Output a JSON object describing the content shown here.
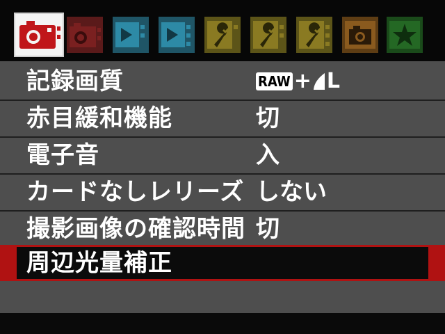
{
  "tabs": [
    {
      "name": "shooting-tab-1",
      "icon": "camera-icon",
      "color": "#c02020",
      "active": true
    },
    {
      "name": "shooting-tab-2",
      "icon": "camera-icon",
      "color": "#c02020",
      "active": false
    },
    {
      "name": "playback-tab-1",
      "icon": "playback-icon",
      "color": "#3aa8c8",
      "active": false
    },
    {
      "name": "playback-tab-2",
      "icon": "playback-icon",
      "color": "#3aa8c8",
      "active": false
    },
    {
      "name": "setup-tab-1",
      "icon": "wrench-icon",
      "color": "#c8b020",
      "active": false
    },
    {
      "name": "setup-tab-2",
      "icon": "wrench-icon",
      "color": "#c8b020",
      "active": false
    },
    {
      "name": "setup-tab-3",
      "icon": "wrench-icon",
      "color": "#c8b020",
      "active": false
    },
    {
      "name": "custom-functions-tab",
      "icon": "camera-icon",
      "color": "#d08a20",
      "active": false
    },
    {
      "name": "my-menu-tab",
      "icon": "star-icon",
      "color": "#38a838",
      "active": false
    }
  ],
  "menu": {
    "items": [
      {
        "label": "記録画質",
        "value_parts": {
          "badge": "RAW",
          "plus": "+",
          "size": "L"
        }
      },
      {
        "label": "赤目緩和機能",
        "value": "切"
      },
      {
        "label": "電子音",
        "value": "入"
      },
      {
        "label": "カードなしレリーズ",
        "value": "しない"
      },
      {
        "label": "撮影画像の確認時間",
        "value": "切"
      },
      {
        "label": "周辺光量補正",
        "value": ""
      }
    ]
  },
  "colors": {
    "background": "#4e4e4e",
    "selected_border": "#b01212",
    "text": "#ffffff"
  }
}
